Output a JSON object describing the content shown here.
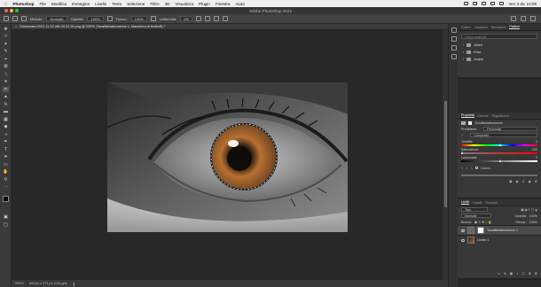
{
  "menubar": {
    "apple": "",
    "app": "Photoshop",
    "items": [
      "File",
      "Modifica",
      "Immagine",
      "Livello",
      "Testo",
      "Selezione",
      "Filtro",
      "3D",
      "Visualizza",
      "Plugin",
      "Finestra",
      "Aiuto"
    ],
    "clock": "Ven 3 dic  10:09"
  },
  "window": {
    "title": "Adobe Photoshop 2022"
  },
  "options": {
    "metodo_label": "Metodo:",
    "metodo_value": "Normale",
    "opacita_label": "Opacità:",
    "opacita_value": "100%",
    "flusso_label": "Flusso:",
    "flusso_value": "100%",
    "unif_label": "Uniformità:",
    "unif_value": "0%"
  },
  "document": {
    "tab_title": "Schermata 2021-11-22 alle 20.51.35.png @ 200% (Tonalità/saturazione 1, Maschera di livello/8) *",
    "zoom": "200%",
    "size": "604 px x 374 px (144 ppi)"
  },
  "panel_top": {
    "tabs": [
      "Colore",
      "Campioni",
      "Sfumature",
      "Pattern"
    ],
    "active_tab": "Pattern",
    "search_placeholder": "Cerca negli stili",
    "folders": [
      "Alberi",
      "Erba",
      "Acqua"
    ]
  },
  "properties": {
    "tabs": [
      "Proprietà",
      "Librerie",
      "Regolazioni"
    ],
    "active_tab": "Proprietà",
    "header": "Tonalità/saturazione",
    "preset_label": "Predefinito:",
    "preset_value": "Personale",
    "channel_value": "Composito",
    "hue_label": "Tonalità:",
    "hue_value": "0",
    "hue_fraction": 0.5,
    "sat_label": "Saturazione:",
    "sat_value": "-100",
    "sat_fraction": 0.0,
    "light_label": "Luminosità:",
    "light_value": "0",
    "light_fraction": 0.5,
    "colorize_label": "Colora",
    "ramp_left": "#6e6e6e",
    "ramp_right": "#6e6e6e"
  },
  "layers": {
    "tabs": [
      "Livelli",
      "Canali",
      "Tracciati"
    ],
    "active_tab": "Livelli",
    "kind_filter": "Tipo",
    "blend_mode": "Normale",
    "opacity_label": "Opacità:",
    "opacity_value": "100%",
    "lock_label": "Blocca:",
    "fill_label": "Riemp.:",
    "fill_value": "100%",
    "rows": [
      {
        "name": "Tonalità/saturazione 1"
      },
      {
        "name": "Livello 1"
      }
    ]
  },
  "colors": {
    "foreground": "#000000",
    "background": "#ffffff",
    "iris_outer": "#6b4424",
    "iris_inner": "#b8702f"
  }
}
